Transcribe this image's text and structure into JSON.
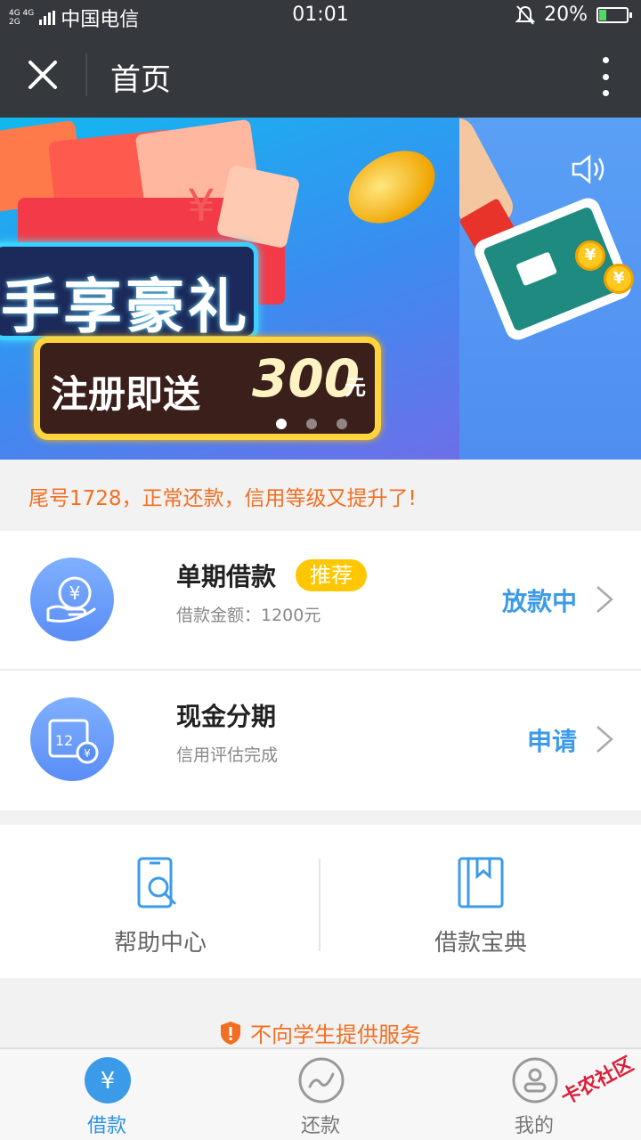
{
  "status_bar": {
    "network_top": "4G 4G",
    "network_bottom": "2G",
    "carrier": "中国电信",
    "time": "01:01",
    "battery_percent": "20%"
  },
  "header": {
    "title": "首页",
    "close_icon": "close-icon",
    "more_icon": "more-vertical-icon"
  },
  "banner": {
    "slide_headline": "手享豪礼",
    "slide_offer_prefix": "注册即送",
    "slide_offer_amount": "300",
    "slide_offer_unit": "元",
    "yuan_symbol": "¥",
    "dot_count": 3,
    "active_dot": 0
  },
  "notice": {
    "text": "尾号1728，正常还款，信用等级又提升了!"
  },
  "loans": [
    {
      "title": "单期借款",
      "tag": "推荐",
      "subtitle": "借款金额：1200元",
      "action": "放款中",
      "icon": "hand-coin-icon"
    },
    {
      "title": "现金分期",
      "tag": "",
      "subtitle": "信用评估完成",
      "action": "申请",
      "icon": "calendar-12-yuan-icon",
      "icon_number": "12",
      "icon_currency": "¥"
    }
  ],
  "help_links": [
    {
      "label": "帮助中心",
      "icon": "phone-search-icon"
    },
    {
      "label": "借款宝典",
      "icon": "bookmark-book-icon"
    }
  ],
  "student_notice": "不向学生提供服务",
  "tabs": [
    {
      "label": "借款",
      "icon": "yuan-icon",
      "active": true
    },
    {
      "label": "还款",
      "icon": "trend-icon",
      "active": false
    },
    {
      "label": "我的",
      "icon": "user-icon",
      "active": false
    }
  ],
  "watermark": "卡农社区",
  "colors": {
    "header_bg": "#35383c",
    "accent_blue": "#3c9be8",
    "notice_orange": "#f26f21",
    "tag_yellow": "#ffc700"
  }
}
